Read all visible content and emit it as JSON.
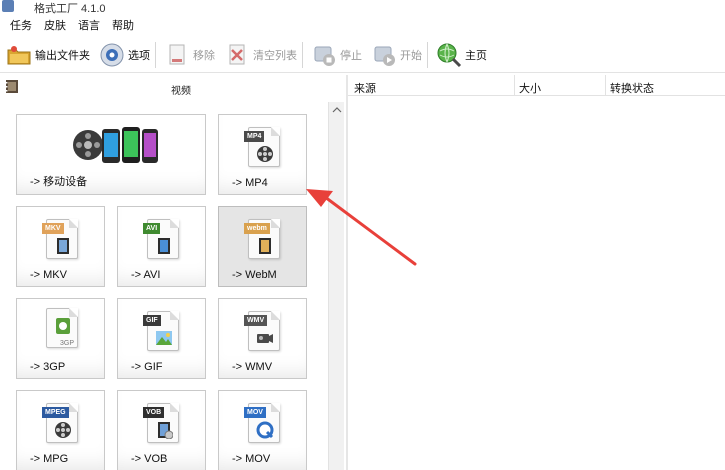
{
  "window": {
    "title": "格式工厂 4.1.0"
  },
  "menu": [
    "任务",
    "皮肤",
    "语言",
    "帮助"
  ],
  "toolbar": {
    "output_folder": "输出文件夹",
    "options": "选项",
    "remove": "移除",
    "clear_list": "清空列表",
    "stop": "停止",
    "start": "开始",
    "home": "主页"
  },
  "category": {
    "title": "视频"
  },
  "tiles": [
    {
      "label": "-> 移动设备",
      "tag": ""
    },
    {
      "label": "-> MP4",
      "tag": "MP4"
    },
    {
      "label": "-> MKV",
      "tag": "MKV"
    },
    {
      "label": "-> AVI",
      "tag": "AVI"
    },
    {
      "label": "-> WebM",
      "tag": "webm"
    },
    {
      "label": "-> 3GP",
      "tag": "3GP"
    },
    {
      "label": "-> GIF",
      "tag": "GIF"
    },
    {
      "label": "-> WMV",
      "tag": "WMV"
    },
    {
      "label": "-> MPG",
      "tag": "MPEG"
    },
    {
      "label": "-> VOB",
      "tag": "VOB"
    },
    {
      "label": "-> MOV",
      "tag": "MOV"
    }
  ],
  "task_list": {
    "columns": [
      "来源",
      "大小",
      "转换状态"
    ]
  },
  "colors": {
    "annotation_arrow": "#e8403a",
    "selected_tile": "#e5e5e5",
    "tag_mp4": "#4a4a4a",
    "tag_mkv": "#e0a25a",
    "tag_avi": "#3f8a2f",
    "tag_webm": "#d9a14e",
    "tag_3gp": "#5a9f3a",
    "tag_gif": "#3a3a3a",
    "tag_wmv": "#555555",
    "tag_mpeg": "#2c5aa0",
    "tag_vob": "#2f2f2f",
    "tag_mov": "#2f6fc4"
  },
  "icons": {
    "app": "app-icon",
    "output_folder": "folder-icon",
    "options": "gear-icon",
    "remove": "remove-document-icon",
    "clear_list": "clear-list-icon",
    "stop": "stop-icon",
    "start": "play-icon",
    "home": "globe-magnifier-icon",
    "category": "film-reel-icon",
    "mobile": "mobile-devices-icon"
  }
}
